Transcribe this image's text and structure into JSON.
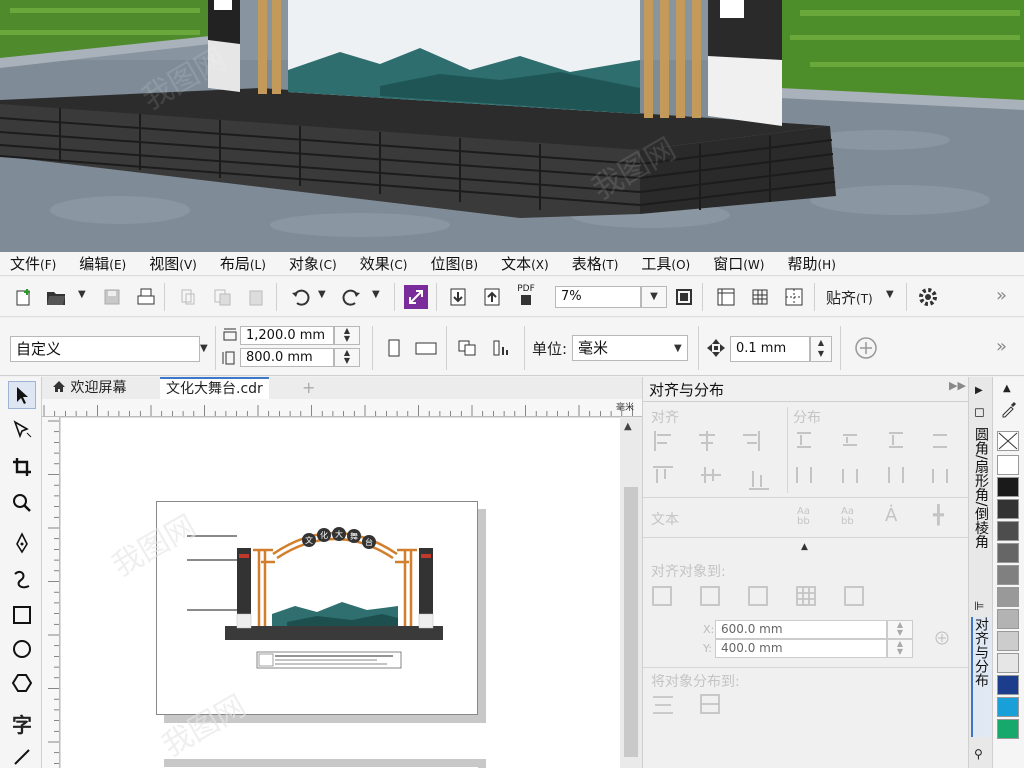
{
  "menu": [
    {
      "label": "文件",
      "accel": "(F)"
    },
    {
      "label": "编辑",
      "accel": "(E)"
    },
    {
      "label": "视图",
      "accel": "(V)"
    },
    {
      "label": "布局",
      "accel": "(L)"
    },
    {
      "label": "对象",
      "accel": "(C)"
    },
    {
      "label": "效果",
      "accel": "(C)"
    },
    {
      "label": "位图",
      "accel": "(B)"
    },
    {
      "label": "文本",
      "accel": "(X)"
    },
    {
      "label": "表格",
      "accel": "(T)"
    },
    {
      "label": "工具",
      "accel": "(O)"
    },
    {
      "label": "窗口",
      "accel": "(W)"
    },
    {
      "label": "帮助",
      "accel": "(H)"
    }
  ],
  "toolbar": {
    "zoom_value": "7%",
    "pdf_label": "PDF",
    "snap_label": "贴齐",
    "snap_accel": "(T)",
    "overflow": "»"
  },
  "propertybar": {
    "page_preset": "自定义",
    "width": "1,200.0 mm",
    "height": "800.0 mm",
    "units_label": "单位:",
    "units_value": "毫米",
    "nudge": "0.1 mm",
    "overflow": "»"
  },
  "tabs": {
    "welcome": "欢迎屏幕",
    "document": "文化大舞台.cdr",
    "add": "+"
  },
  "ruler": {
    "unit": "毫米"
  },
  "artwork": {
    "arch_title": [
      "文",
      "化",
      "大",
      "舞",
      "台"
    ]
  },
  "docker": {
    "title": "对齐与分布",
    "align_label": "对齐",
    "distribute_label": "分布",
    "text_label": "文本",
    "align_to_label": "对齐对象到:",
    "x_label": "X:",
    "x_value": "600.0 mm",
    "y_label": "Y:",
    "y_value": "400.0 mm",
    "distribute_to_label": "将对象分布到:"
  },
  "docker_tabs": {
    "fillet": "圆角/扇形角/倒棱角",
    "align": "对齐与分布"
  },
  "palette_colors": [
    "#ffffff",
    "#1a1a1a",
    "#333333",
    "#4d4d4d",
    "#666666",
    "#808080",
    "#999999",
    "#b3b3b3",
    "#cccccc",
    "#e6e6e6",
    "#1c3c8c",
    "#1aa0d8",
    "#17a96b"
  ]
}
